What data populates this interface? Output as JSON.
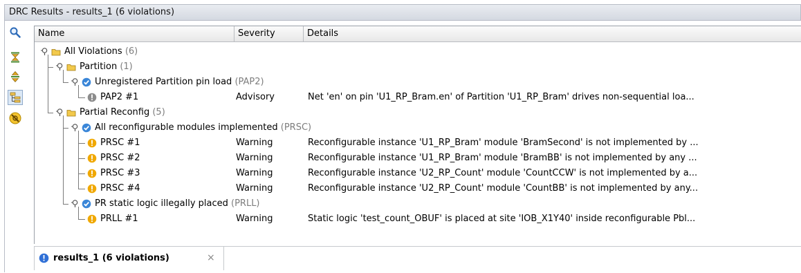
{
  "window": {
    "title": "DRC Results - results_1 (6 violations)"
  },
  "toolbar": {
    "buttons": [
      {
        "name": "search-icon"
      },
      {
        "name": "collapse-all-icon"
      },
      {
        "name": "expand-all-icon"
      },
      {
        "name": "group-by-icon",
        "active": true
      },
      {
        "name": "clear-results-icon"
      }
    ]
  },
  "table": {
    "columns": [
      "Name",
      "Severity",
      "Details"
    ],
    "rows": [
      {
        "level": 0,
        "type": "folder",
        "name": "All Violations",
        "count": "(6)"
      },
      {
        "level": 1,
        "type": "folder",
        "name": "Partition",
        "count": "(1)"
      },
      {
        "level": 2,
        "type": "check",
        "name": "Unregistered Partition pin load",
        "count": "(PAP2)"
      },
      {
        "level": 3,
        "type": "info",
        "name": "PAP2 #1",
        "severity": "Advisory",
        "details": "Net 'en' on pin 'U1_RP_Bram.en' of Partition 'U1_RP_Bram' drives non-sequential loa..."
      },
      {
        "level": 1,
        "type": "folder",
        "name": "Partial Reconfig",
        "count": "(5)"
      },
      {
        "level": 2,
        "type": "check",
        "name": "All reconfigurable modules implemented",
        "count": "(PRSC)"
      },
      {
        "level": 3,
        "type": "warn",
        "name": "PRSC #1",
        "severity": "Warning",
        "details": "Reconfigurable instance 'U1_RP_Bram' module 'BramSecond' is not implemented by ..."
      },
      {
        "level": 3,
        "type": "warn",
        "name": "PRSC #2",
        "severity": "Warning",
        "details": "Reconfigurable instance 'U1_RP_Bram' module 'BramBB' is not implemented by any ..."
      },
      {
        "level": 3,
        "type": "warn",
        "name": "PRSC #3",
        "severity": "Warning",
        "details": "Reconfigurable instance 'U2_RP_Count' module 'CountCCW' is not implemented by a..."
      },
      {
        "level": 3,
        "type": "warn",
        "name": "PRSC #4",
        "severity": "Warning",
        "details": "Reconfigurable instance 'U2_RP_Count' module 'CountBB' is not implemented by any..."
      },
      {
        "level": 2,
        "type": "check",
        "name": "PR static logic illegally placed",
        "count": "(PRLL)"
      },
      {
        "level": 3,
        "type": "warn",
        "name": "PRLL #1",
        "severity": "Warning",
        "details": "Static logic 'test_count_OBUF' is placed at site 'IOB_X1Y40' inside reconfigurable Pbl..."
      }
    ]
  },
  "tabs": [
    {
      "label": "results_1 (6 violations)",
      "close": "×"
    }
  ],
  "colors": {
    "folder": "#f2c94c",
    "check": "#3a86d8",
    "warn": "#f0a800",
    "info": "#8c8c8c",
    "tab_icon": "#2f6fd6"
  }
}
